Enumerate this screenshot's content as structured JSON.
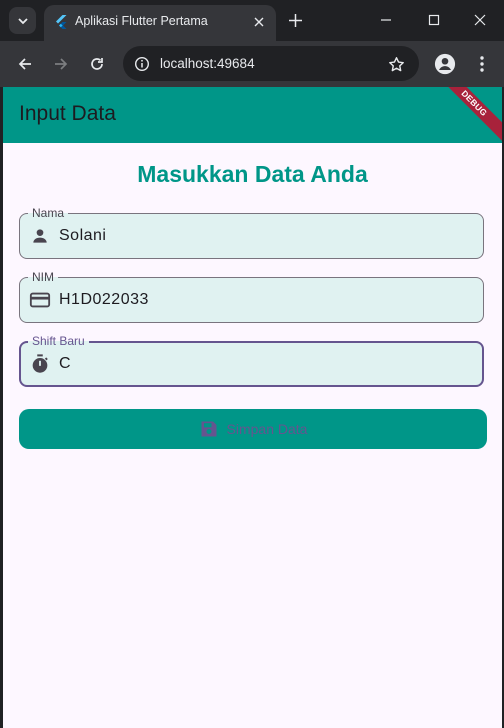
{
  "browser": {
    "tab_title": "Aplikasi Flutter Pertama",
    "url": "localhost:49684"
  },
  "app": {
    "appbar_title": "Input Data",
    "debug_banner": "DEBUG",
    "heading": "Masukkan Data Anda",
    "primary_color": "#009688",
    "field_fill_color": "#e0f2f1",
    "focus_color": "#65558f",
    "fields": [
      {
        "label": "Nama",
        "value": "Solani",
        "icon": "person-icon"
      },
      {
        "label": "NIM",
        "value": "H1D022033",
        "icon": "credit-card-icon"
      },
      {
        "label": "Shift Baru",
        "value": "C",
        "icon": "timer-icon",
        "focused": true
      }
    ],
    "submit": {
      "label": "Simpan Data",
      "icon": "save-icon"
    }
  }
}
